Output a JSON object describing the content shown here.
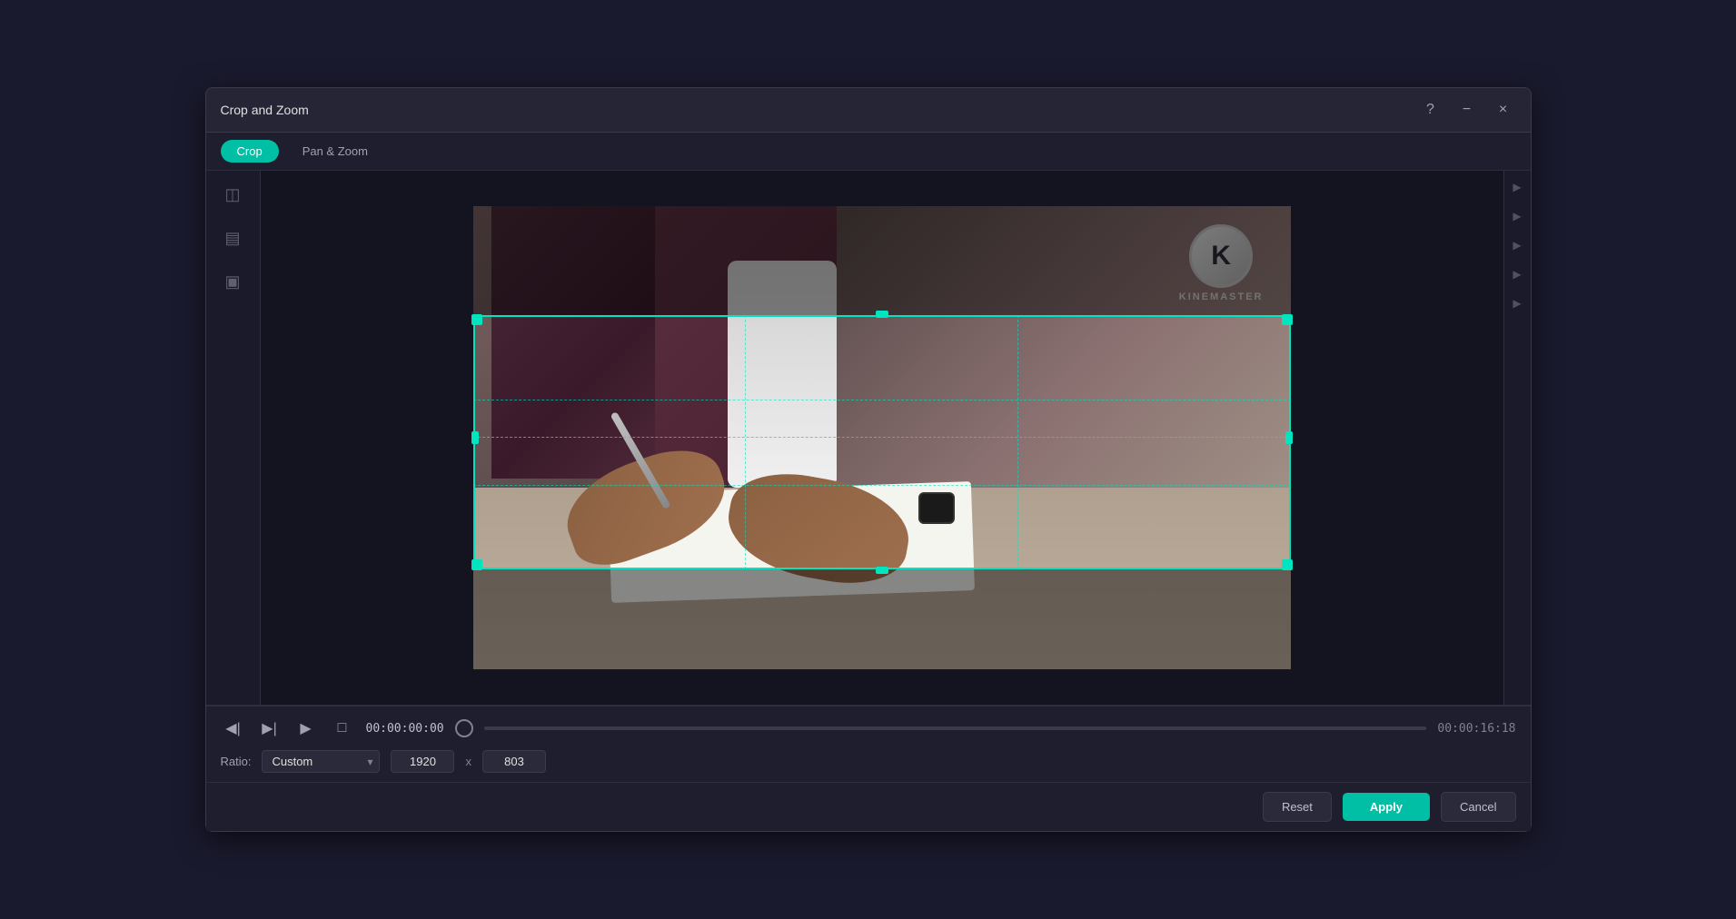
{
  "dialog": {
    "title": "Crop and Zoom",
    "tabs": [
      {
        "label": "Crop",
        "active": true
      },
      {
        "label": "Pan & Zoom",
        "active": false
      }
    ]
  },
  "toolbar": {
    "help_icon": "?",
    "minimize_icon": "−",
    "close_icon": "×"
  },
  "playback": {
    "current_time": "00:00:00:00",
    "total_time": "00:00:16:18"
  },
  "ratio": {
    "label": "Ratio:",
    "value": "Custom",
    "width": "1920",
    "height": "803",
    "separator": "x"
  },
  "actions": {
    "reset_label": "Reset",
    "apply_label": "Apply",
    "cancel_label": "Cancel"
  },
  "watermark": {
    "logo": "K",
    "text": "KINEMASTER"
  }
}
